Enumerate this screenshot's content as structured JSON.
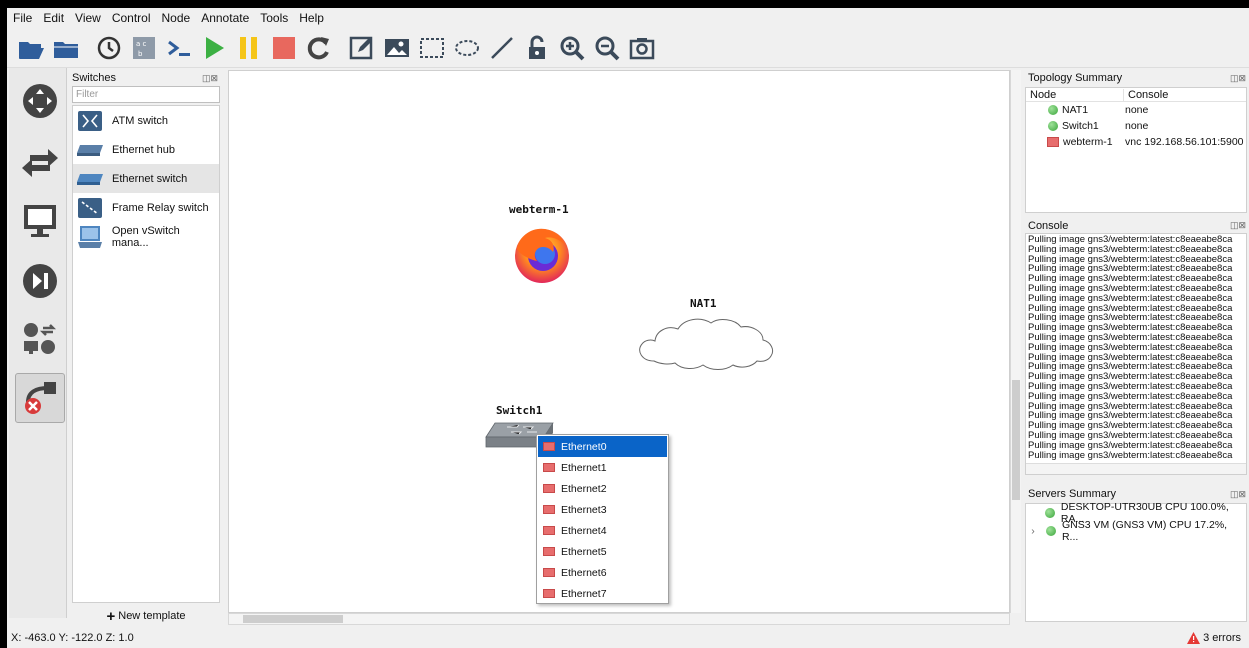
{
  "menu": [
    "File",
    "Edit",
    "View",
    "Control",
    "Node",
    "Annotate",
    "Tools",
    "Help"
  ],
  "toolbar_icons": [
    "open-folder-icon",
    "folder-icon",
    "clock-icon",
    "snapshot-icon",
    "console-icon",
    "start-icon",
    "pause-icon",
    "stop-icon",
    "reload-icon",
    "note-icon",
    "image-icon",
    "rectangle-icon",
    "ellipse-icon",
    "line-icon",
    "lock-icon",
    "zoom-in-icon",
    "zoom-out-icon",
    "screenshot-icon"
  ],
  "switches_panel": {
    "title": "Switches",
    "filter_placeholder": "Filter",
    "items": [
      {
        "label": "ATM switch",
        "icon": "atm-switch-icon"
      },
      {
        "label": "Ethernet hub",
        "icon": "ethernet-hub-icon"
      },
      {
        "label": "Ethernet switch",
        "icon": "ethernet-switch-icon",
        "selected": true
      },
      {
        "label": "Frame Relay switch",
        "icon": "frame-relay-switch-icon"
      },
      {
        "label": "Open vSwitch mana...",
        "icon": "open-vswitch-icon"
      }
    ],
    "new_template": "New template"
  },
  "canvas": {
    "nodes": [
      {
        "label": "webterm-1",
        "icon": "firefox-icon"
      },
      {
        "label": "NAT1",
        "icon": "cloud-icon"
      },
      {
        "label": "Switch1",
        "icon": "switch-icon"
      }
    ],
    "context_menu": [
      "Ethernet0",
      "Ethernet1",
      "Ethernet2",
      "Ethernet3",
      "Ethernet4",
      "Ethernet5",
      "Ethernet6",
      "Ethernet7"
    ],
    "highlighted": "Ethernet0"
  },
  "topology_summary": {
    "title": "Topology Summary",
    "col_node": "Node",
    "col_console": "Console",
    "rows": [
      {
        "node": "NAT1",
        "console": "none",
        "status": "green"
      },
      {
        "node": "Switch1",
        "console": "none",
        "status": "green"
      },
      {
        "node": "webterm-1",
        "console": "vnc 192.168.56.101:5900",
        "status": "stopped"
      }
    ]
  },
  "console": {
    "title": "Console",
    "lines": [
      "Pulling image gns3/webterm:latest:c8eaeabe8ca",
      "Pulling image gns3/webterm:latest:c8eaeabe8ca",
      "Pulling image gns3/webterm:latest:c8eaeabe8ca",
      "Pulling image gns3/webterm:latest:c8eaeabe8ca",
      "Pulling image gns3/webterm:latest:c8eaeabe8ca",
      "Pulling image gns3/webterm:latest:c8eaeabe8ca",
      "Pulling image gns3/webterm:latest:c8eaeabe8ca",
      "Pulling image gns3/webterm:latest:c8eaeabe8ca",
      "Pulling image gns3/webterm:latest:c8eaeabe8ca",
      "Pulling image gns3/webterm:latest:c8eaeabe8ca",
      "Pulling image gns3/webterm:latest:c8eaeabe8ca",
      "Pulling image gns3/webterm:latest:c8eaeabe8ca",
      "Pulling image gns3/webterm:latest:c8eaeabe8ca",
      "Pulling image gns3/webterm:latest:c8eaeabe8ca",
      "Pulling image gns3/webterm:latest:c8eaeabe8ca",
      "Pulling image gns3/webterm:latest:c8eaeabe8ca",
      "Pulling image gns3/webterm:latest:c8eaeabe8ca",
      "Pulling image gns3/webterm:latest:c8eaeabe8ca",
      "Pulling image gns3/webterm:latest:c8eaeabe8ca",
      "Pulling image gns3/webterm:latest:c8eaeabe8ca",
      "Pulling image gns3/webterm:latest:c8eaeabe8ca",
      "Pulling image gns3/webterm:latest:c8eaeabe8ca",
      "Pulling image gns3/webterm:latest:c8eaeabe8ca"
    ]
  },
  "servers_summary": {
    "title": "Servers Summary",
    "rows": [
      {
        "label": "DESKTOP-UTR30UB CPU 100.0%, RA...",
        "expander": ""
      },
      {
        "label": "GNS3 VM (GNS3 VM) CPU 17.2%, R...",
        "expander": "›"
      }
    ]
  },
  "status": {
    "coords": "X: -463.0 Y: -122.0 Z: 1.0",
    "errors": "3 errors"
  }
}
